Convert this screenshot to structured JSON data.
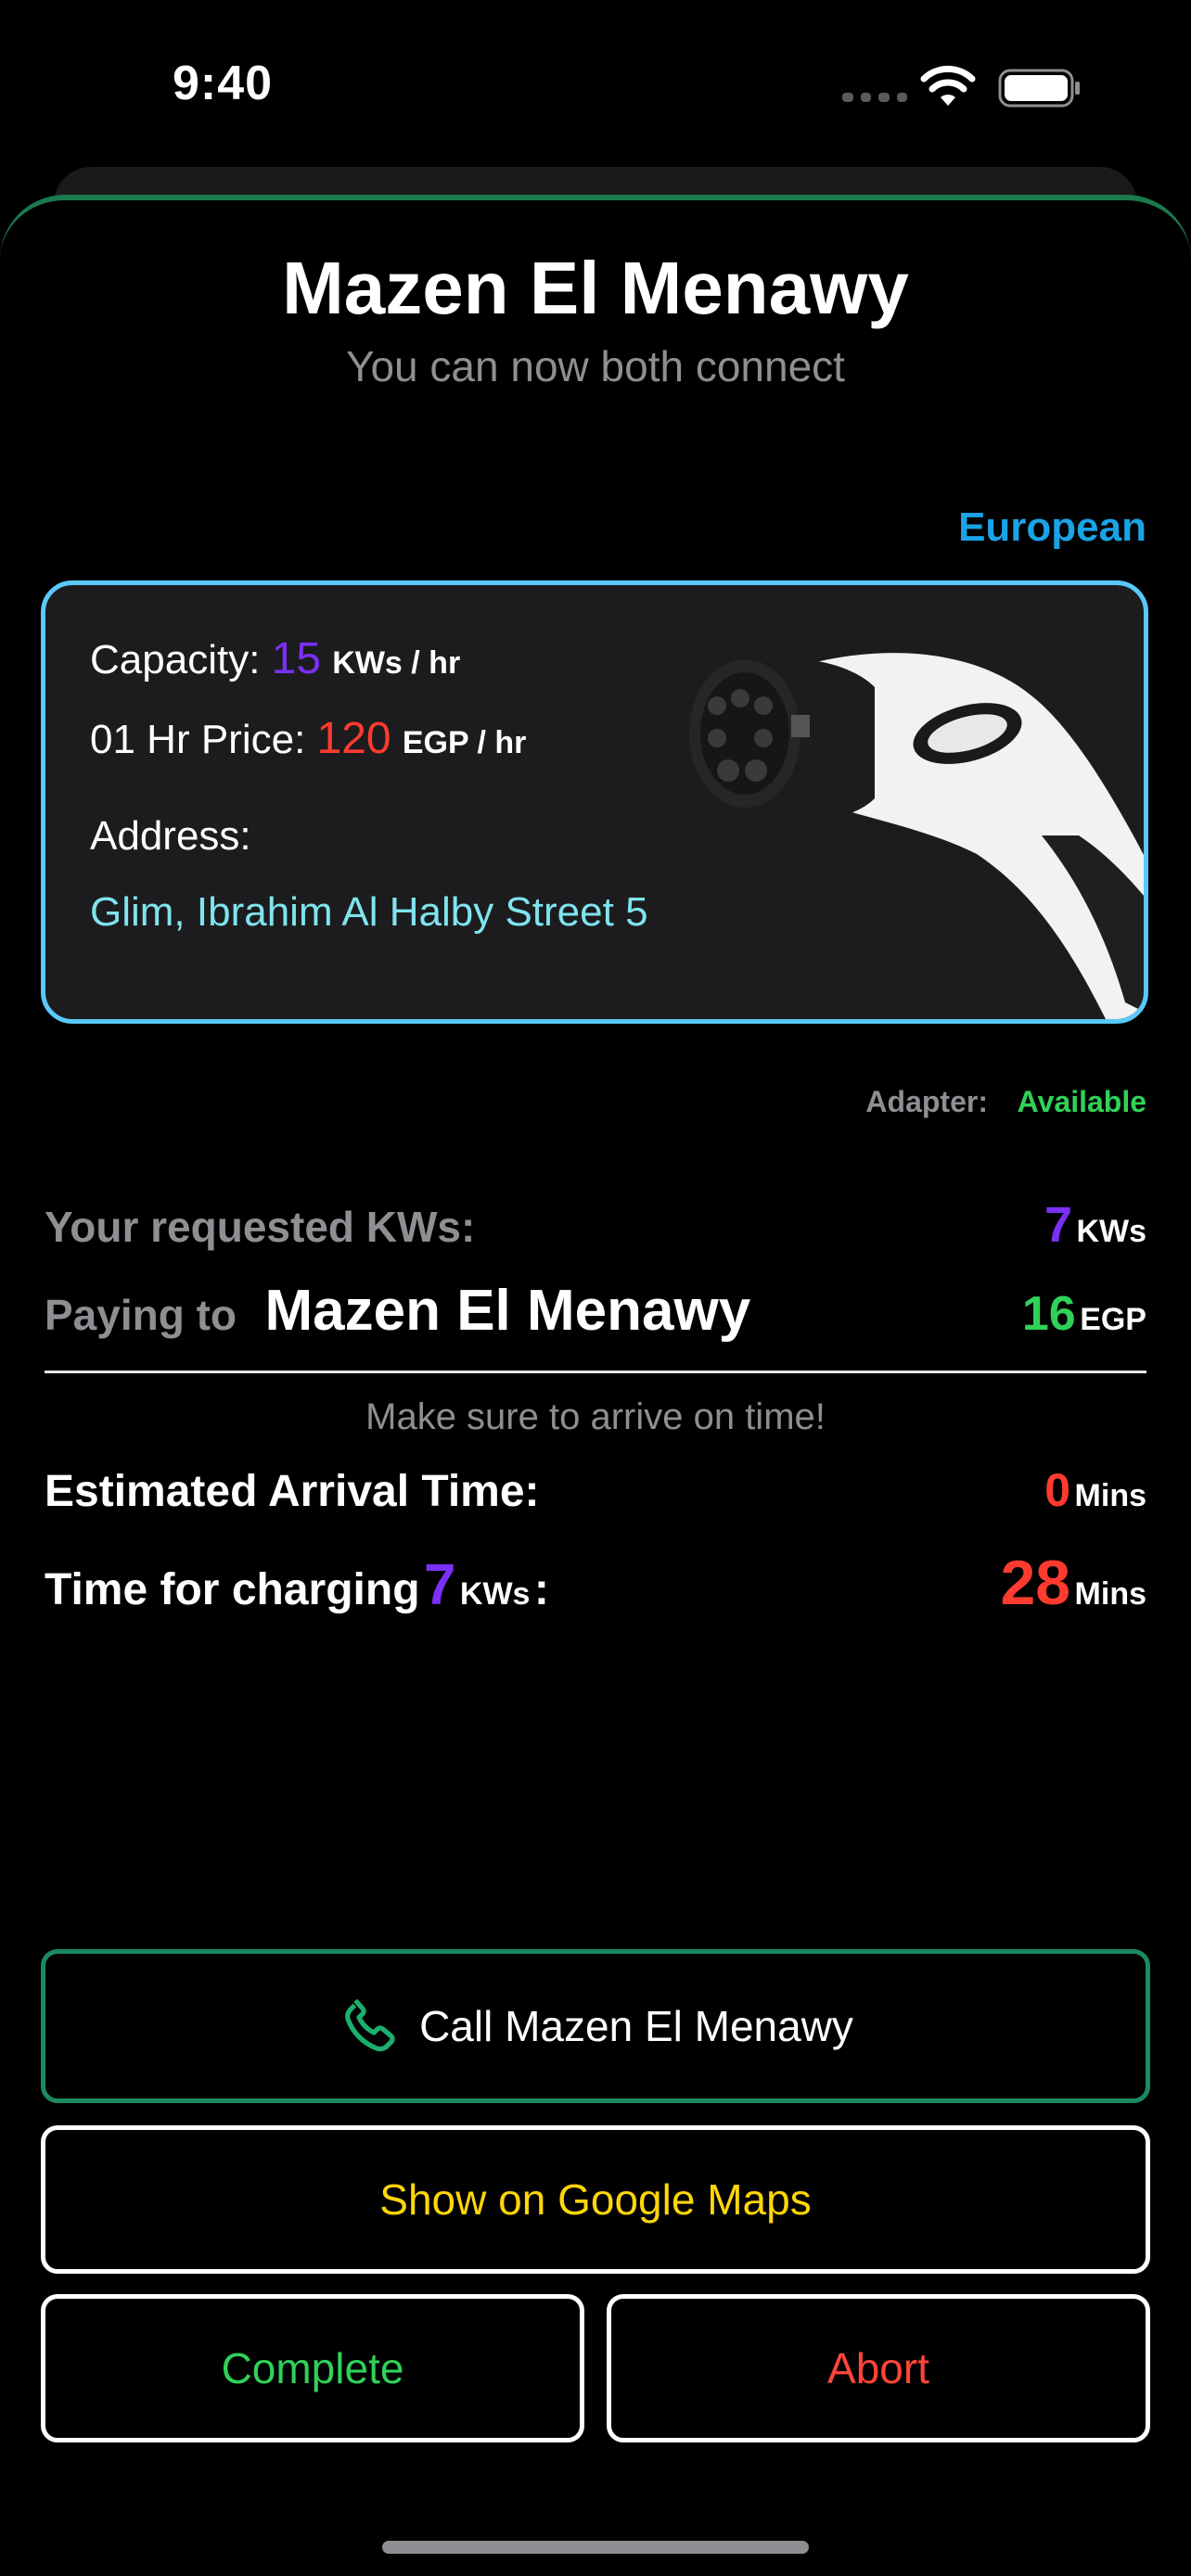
{
  "status_bar": {
    "time": "9:40"
  },
  "header": {
    "title": "Mazen El Menawy",
    "subtitle": "You can now both connect"
  },
  "connector": {
    "type": "European",
    "capacity_label": "Capacity:",
    "capacity_value": "15",
    "capacity_unit": "KWs / hr",
    "price_label": "01 Hr Price:",
    "price_value": "120",
    "price_unit": "EGP / hr",
    "address_label": "Address:",
    "address_value": "Glim, Ibrahim Al Halby Street 5"
  },
  "adapter": {
    "label": "Adapter:",
    "value": "Available"
  },
  "request": {
    "requested_label": "Your requested KWs:",
    "requested_value": "7",
    "requested_unit": "KWs",
    "paying_label": "Paying to",
    "paying_name": "Mazen El Menawy",
    "paying_value": "16",
    "paying_unit": "EGP"
  },
  "timing": {
    "note": "Make sure to arrive on time!",
    "eta_label": "Estimated Arrival Time:",
    "eta_value": "0",
    "eta_unit": "Mins",
    "charge_label": "Time for charging",
    "charge_kws": "7",
    "charge_kws_unit": "KWs",
    "charge_colon": ":",
    "charge_value": "28",
    "charge_unit": "Mins"
  },
  "actions": {
    "call_label": "Call Mazen El Menawy",
    "maps_label": "Show on Google Maps",
    "complete_label": "Complete",
    "abort_label": "Abort"
  },
  "colors": {
    "accent_green": "#30d158",
    "accent_blue": "#1aa3e6",
    "card_border": "#5ac8fa",
    "purple": "#7b2ff7",
    "red": "#ff3b30",
    "yellow": "#ffd60a"
  },
  "icons": {
    "call": "phone-icon",
    "wifi": "wifi-icon",
    "battery": "battery-icon",
    "charger": "ev-connector-image"
  }
}
